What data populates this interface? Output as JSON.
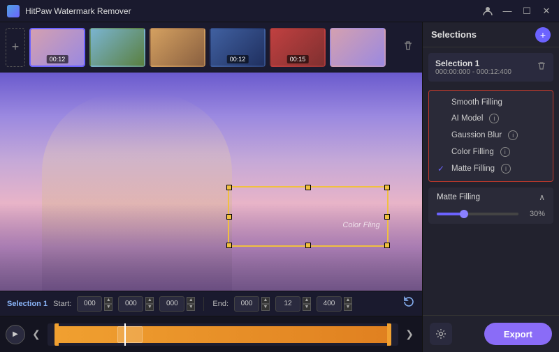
{
  "titlebar": {
    "app_name": "HitPaw Watermark Remover",
    "minimize": "—",
    "maximize": "☐",
    "close": "✕"
  },
  "thumbnail_strip": {
    "add_label": "+",
    "thumbs": [
      {
        "id": "thumb-1",
        "label": "00:12",
        "active": true
      },
      {
        "id": "thumb-2",
        "label": "",
        "active": false
      },
      {
        "id": "thumb-3",
        "label": "",
        "active": false
      },
      {
        "id": "thumb-4",
        "label": "00:12",
        "active": false
      },
      {
        "id": "thumb-5",
        "label": "00:15",
        "active": false
      },
      {
        "id": "thumb-6",
        "label": "",
        "active": false
      }
    ]
  },
  "controls": {
    "selection_label": "Selection 1",
    "start_label": "Start:",
    "start_h": "000",
    "start_m": "000",
    "start_s": "000",
    "end_label": "End:",
    "end_h": "000",
    "end_m": "12",
    "end_s": "400"
  },
  "right_panel": {
    "title": "Selections",
    "add_icon": "+",
    "selection1": {
      "name": "Selection 1",
      "time": "000:00:000 - 000:12:400"
    },
    "filling_options": {
      "smooth_filling": "Smooth Filling",
      "ai_model": "AI Model",
      "gaussian_blur": "Gaussion Blur",
      "color_filling": "Color Filling",
      "matte_filling": "Matte Filling",
      "checked": "matte_filling"
    },
    "matte_section": {
      "label": "Matte Filling",
      "percent": "30%",
      "slider_value": 30
    },
    "export_label": "Export"
  },
  "color_fling": {
    "text": "Color Fling"
  },
  "timeline": {
    "play_icon": "▶"
  }
}
